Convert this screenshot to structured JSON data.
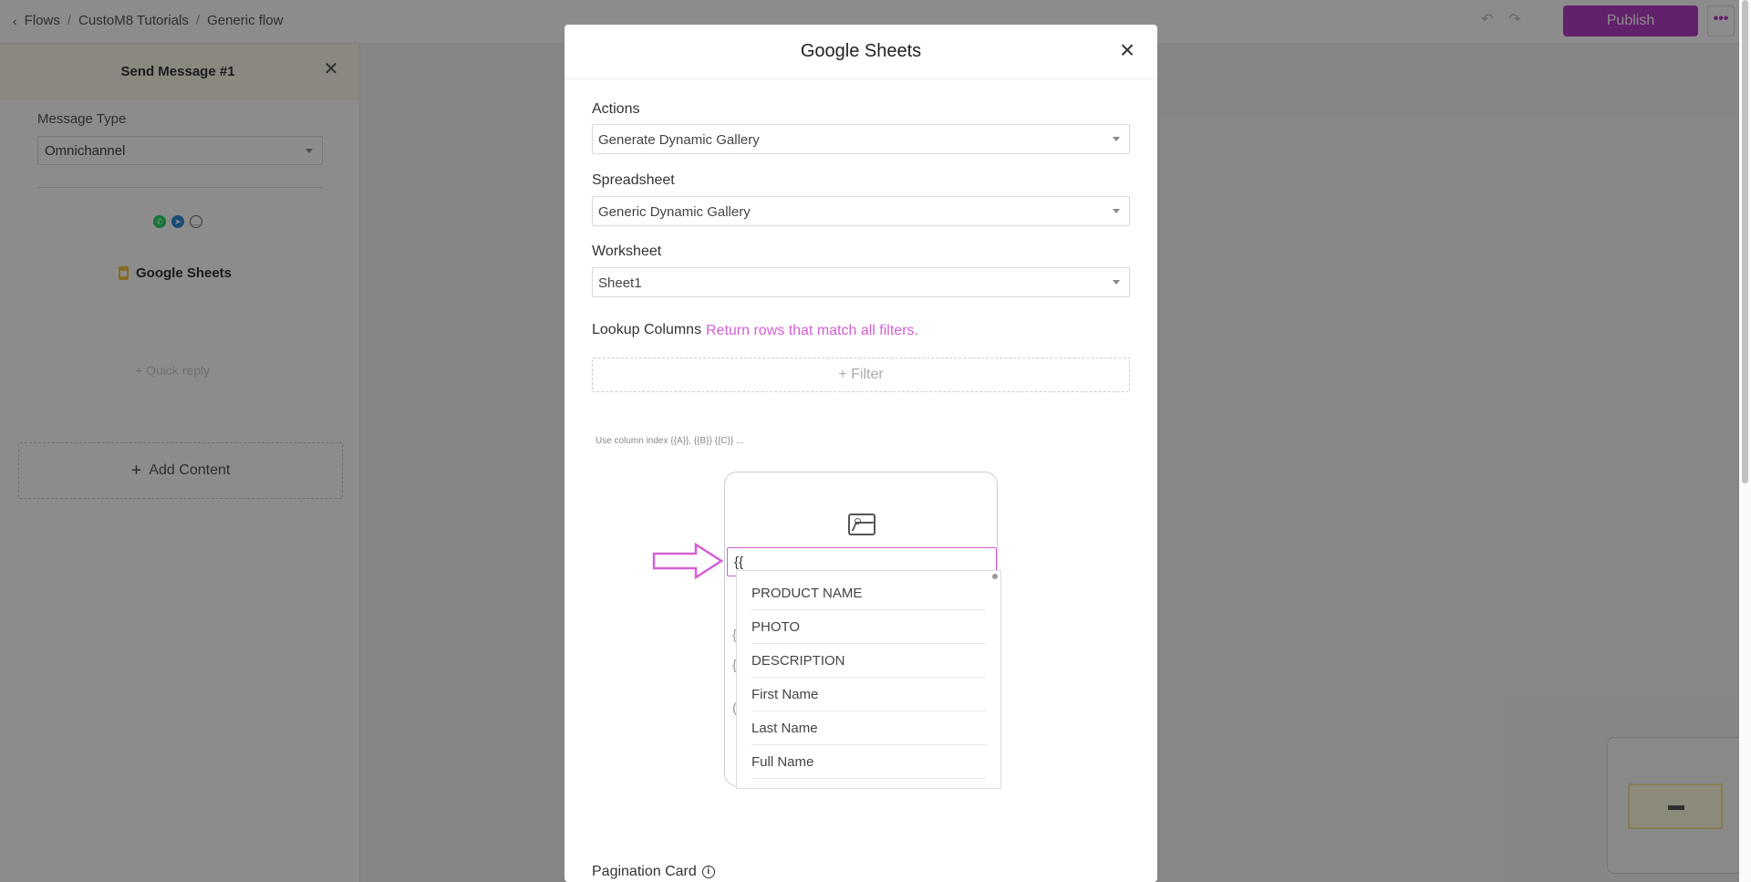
{
  "topbar": {
    "breadcrumb": [
      "Flows",
      "CustoM8 Tutorials",
      "Generic flow"
    ],
    "separator": "/",
    "publish_label": "Publish",
    "more_label": "•••"
  },
  "left_panel": {
    "title": "Send Message #1",
    "message_type_label": "Message Type",
    "message_type_value": "Omnichannel",
    "content_label": "Google Sheets",
    "quick_reply": "+ Quick reply",
    "add_content": "Add Content"
  },
  "modal": {
    "title": "Google Sheets",
    "actions_label": "Actions",
    "actions_value": "Generate Dynamic Gallery",
    "spreadsheet_label": "Spreadsheet",
    "spreadsheet_value": "Generic Dynamic Gallery",
    "worksheet_label": "Worksheet",
    "worksheet_value": "Sheet1",
    "lookup_label": "Lookup Columns",
    "lookup_hint": "Return rows that match all filters.",
    "filter_label": "+ Filter",
    "column_hint": "Use column index {{A}}, {{B}} {{C}} ...",
    "card": {
      "title_input_value": "{{",
      "line1": "{",
      "line2": "{",
      "line3": "("
    },
    "dropdown_options": [
      "PRODUCT NAME",
      "PHOTO",
      "DESCRIPTION",
      "First Name",
      "Last Name",
      "Full Name"
    ],
    "pagination_label": "Pagination Card"
  },
  "colors": {
    "accent": "#b23cc3",
    "highlight": "#d45fd6"
  }
}
